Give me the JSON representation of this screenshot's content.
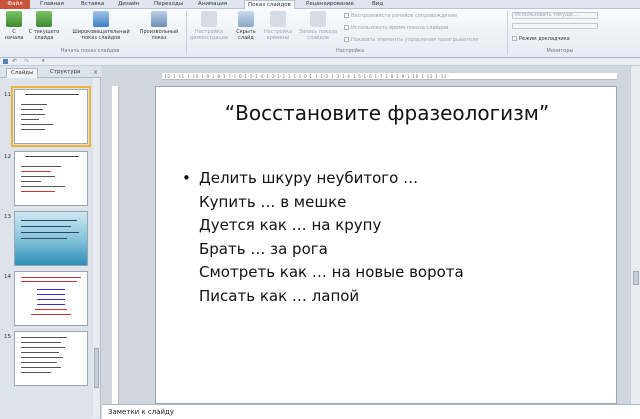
{
  "ribbon_tabs": {
    "file": "Файл",
    "items": [
      "Главная",
      "Вставка",
      "Дизайн",
      "Переходы",
      "Анимация",
      "Показ слайдов",
      "Рецензирование",
      "Вид"
    ],
    "active": "Показ слайдов"
  },
  "ribbon": {
    "start_group": {
      "from_start": "С начала",
      "from_current": "С текущего слайда",
      "broadcast": "Широковещательный показ слайдов",
      "custom": "Произвольный показ",
      "label": "Начать показ слайдов"
    },
    "setup_group": {
      "setup": "Настройка демонстрации",
      "hide": "Скрыть слайд",
      "rehearse": "Настройка времени",
      "record": "Запись показа слайдов",
      "play_narrations": "Воспроизвести речевое сопровождение",
      "use_timings": "Использовать время показа слайдов",
      "show_controls": "Показать элементы управления проигрывателя",
      "label": "Настройка"
    },
    "monitors_group": {
      "monitor_value": "Использовать текуще...",
      "presenter_view": "Режим докладчика",
      "label": "Мониторы"
    }
  },
  "left_panel": {
    "tabs": [
      "Слайды",
      "Структура"
    ],
    "close": "×",
    "slide_numbers": [
      "11",
      "12",
      "13",
      "14",
      "15"
    ]
  },
  "ruler_text": "·12·1·11·1·10·1·9·1·8·1·7·1·6·1·5·1·4·1·3·1·2·1·1·1·0·1·1·1·2·1·3·1·4·1·5·1·6·1·7·1·8·1·9·1·10·1·11·1·12·",
  "slide": {
    "title": "“Восстановите фразеологизм”",
    "bullet": "•",
    "lines": [
      "Делить шкуру неубитого …",
      "Купить … в мешке",
      "Дуется как … на крупу",
      "Брать … за рога",
      "Смотреть как … на новые ворота",
      "Писать как … лапой"
    ]
  },
  "notes": "Заметки к слайду",
  "colors": {
    "file_tab": "#c8543c",
    "selected_thumb": "#f3b233"
  }
}
